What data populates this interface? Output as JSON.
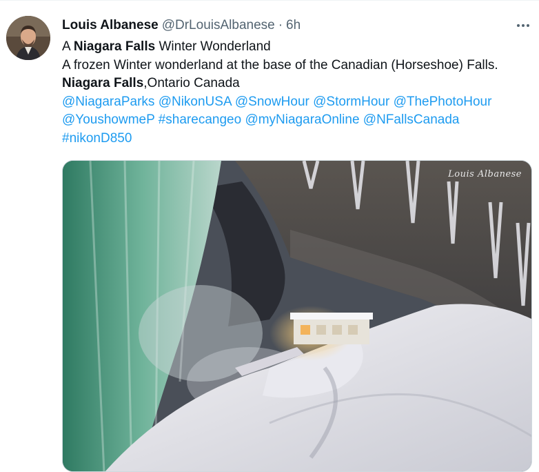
{
  "tweet": {
    "author_name": "Louis Albanese",
    "author_handle": "@DrLouisAlbanese",
    "separator": "·",
    "time": "6h",
    "line1_prefix": "A ",
    "line1_bold": "Niagara Falls",
    "line1_suffix": " Winter Wonderland",
    "line2": "A frozen Winter wonderland at the base of the Canadian (Horseshoe) Falls.",
    "line3_bold": "Niagara Falls",
    "line3_suffix": ",Ontario Canada",
    "mentions_row1": [
      "@NiagaraParks",
      "@NikonUSA",
      "@SnowHour",
      "@StormHour",
      "@ThePhotoHour"
    ],
    "mentions_row2": [
      "@YoushowmeP",
      "#sharecangeo",
      "@myNiagaraOnline",
      "@NFallsCanada"
    ],
    "mentions_row3": [
      "#nikonD850"
    ],
    "photo_signature": "Louis Albanese"
  },
  "icons": {
    "more": "more-horizontal-icon"
  },
  "colors": {
    "link": "#1d9bf0",
    "secondary_text": "#536471",
    "text": "#0f1419"
  }
}
